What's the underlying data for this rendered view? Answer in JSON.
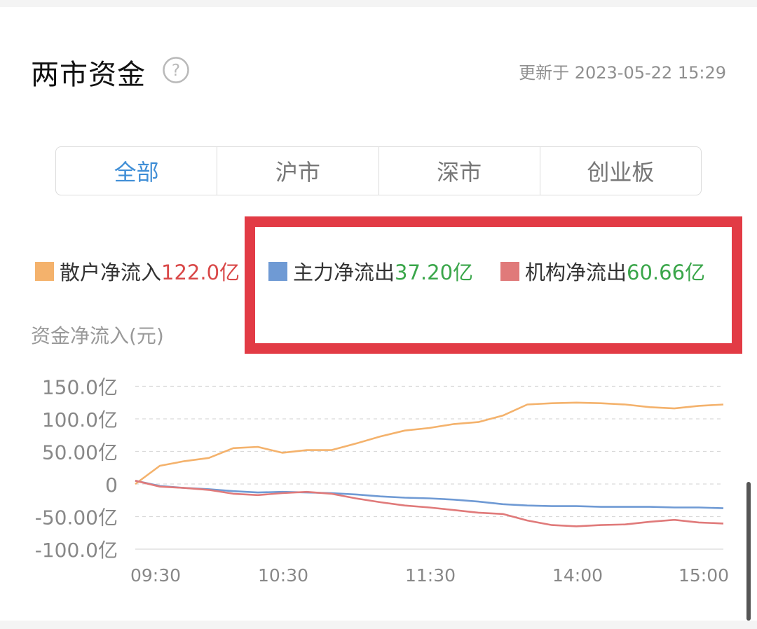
{
  "header": {
    "title": "两市资金",
    "update_text": "更新于 2023-05-22 15:29"
  },
  "tabs": [
    {
      "label": "全部",
      "active": true
    },
    {
      "label": "沪市",
      "active": false
    },
    {
      "label": "深市",
      "active": false
    },
    {
      "label": "创业板",
      "active": false
    }
  ],
  "legend": [
    {
      "label": "散户净流入",
      "value": "122.0亿",
      "swatch_color": "#f4b26c",
      "value_color": "#d94848"
    },
    {
      "label": "主力净流出",
      "value": "37.20亿",
      "swatch_color": "#6f9ad4",
      "value_color": "#3aa64a"
    },
    {
      "label": "机构净流出",
      "value": "60.66亿",
      "swatch_color": "#e07a7a",
      "value_color": "#3aa64a"
    }
  ],
  "chart_data": {
    "type": "line",
    "ylabel": "资金净流入(元)",
    "ylim": [
      -100,
      150
    ],
    "yticks": [
      150,
      100,
      50,
      0,
      -50,
      -100
    ],
    "ytick_labels": [
      "150.0亿",
      "100.0亿",
      "50.00亿",
      "0",
      "-50.00亿",
      "-100.0亿"
    ],
    "xticks": [
      "09:30",
      "10:30",
      "11:30",
      "14:00",
      "15:00"
    ],
    "grid": true,
    "x": [
      "09:30",
      "09:40",
      "09:50",
      "10:00",
      "10:10",
      "10:20",
      "10:30",
      "10:40",
      "10:50",
      "11:00",
      "11:10",
      "11:20",
      "11:30",
      "13:10",
      "13:20",
      "13:30",
      "13:40",
      "13:50",
      "14:00",
      "14:10",
      "14:20",
      "14:30",
      "14:40",
      "14:50",
      "15:00"
    ],
    "series": [
      {
        "name": "散户净流入",
        "color": "#f4b26c",
        "values": [
          0,
          28,
          35,
          40,
          55,
          57,
          48,
          52,
          52,
          62,
          73,
          82,
          86,
          92,
          95,
          105,
          122,
          124,
          125,
          124,
          122,
          118,
          116,
          120,
          122
        ]
      },
      {
        "name": "主力净流出",
        "color": "#6f9ad4",
        "values": [
          5,
          -3,
          -6,
          -8,
          -11,
          -13,
          -12,
          -13,
          -14,
          -16,
          -19,
          -21,
          -22,
          -24,
          -27,
          -31,
          -33,
          -34,
          -34,
          -35,
          -35,
          -35,
          -36,
          -36,
          -37.2
        ]
      },
      {
        "name": "机构净流出",
        "color": "#e07a7a",
        "values": [
          5,
          -4,
          -6,
          -9,
          -15,
          -17,
          -14,
          -12,
          -15,
          -22,
          -28,
          -33,
          -36,
          -40,
          -44,
          -46,
          -56,
          -63,
          -65,
          -63,
          -62,
          -58,
          -55,
          -59,
          -60.66
        ]
      }
    ]
  }
}
